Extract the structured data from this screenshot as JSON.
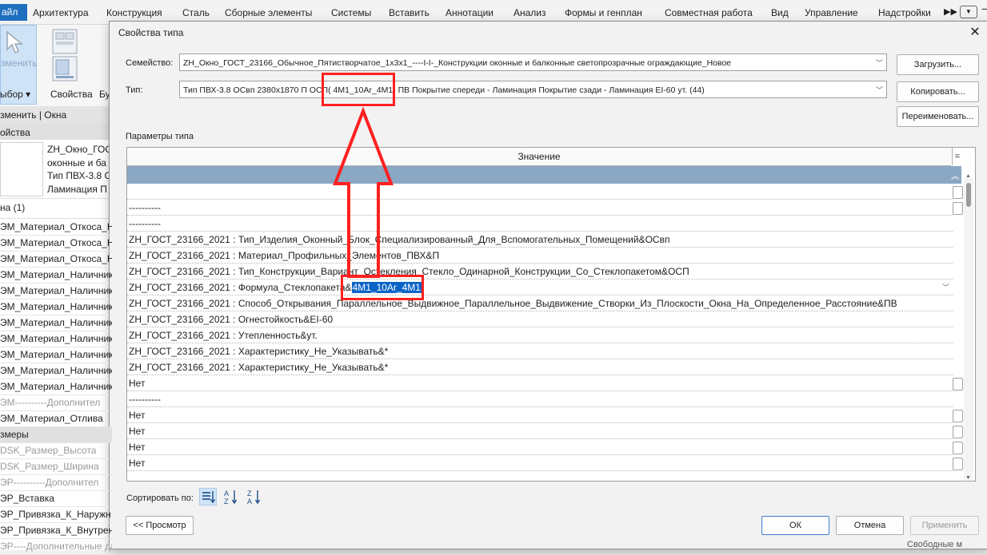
{
  "ribbon": {
    "file_tab": "айл",
    "tabs": [
      "Архитектура",
      "Конструкция",
      "Сталь",
      "Сборные элементы",
      "Системы",
      "Вставить",
      "Аннотации",
      "Анализ",
      "Формы и генплан",
      "Совместная работа",
      "Вид",
      "Управление",
      "Надстройки"
    ],
    "more": "▶▶",
    "select_text": "зменить",
    "select_label": "ыбор ▾",
    "props_label": "Свойства",
    "b_label": "Бу"
  },
  "modify_bar": "зменить | Окна",
  "left_panel": {
    "title": "ойства",
    "type_lines": [
      "ZH_Окно_ГОС",
      "оконные и ба",
      "Тип ПВХ-3.8 О",
      "Ламинация П"
    ],
    "filter": "на (1)",
    "rows": [
      {
        "text": "ЭМ_Материал_Откоса_Н",
        "kind": "normal"
      },
      {
        "text": "ЭМ_Материал_Откоса_Н",
        "kind": "normal"
      },
      {
        "text": "ЭМ_Материал_Откоса_Н",
        "kind": "normal"
      },
      {
        "text": "ЭМ_Материал_Наличник",
        "kind": "normal"
      },
      {
        "text": "ЭМ_Материал_Наличник",
        "kind": "normal"
      },
      {
        "text": "ЭМ_Материал_Наличник",
        "kind": "normal"
      },
      {
        "text": "ЭМ_Материал_Наличник",
        "kind": "normal"
      },
      {
        "text": "ЭМ_Материал_Наличник",
        "kind": "normal"
      },
      {
        "text": "ЭМ_Материал_Наличник",
        "kind": "normal"
      },
      {
        "text": "ЭМ_Материал_Наличник",
        "kind": "normal"
      },
      {
        "text": "ЭМ_Материал_Наличник",
        "kind": "normal"
      },
      {
        "text": "ЭМ----------Дополнител",
        "kind": "grey"
      },
      {
        "text": "ЭМ_Материал_Отлива",
        "kind": "normal"
      },
      {
        "text": "змеры",
        "kind": "group"
      },
      {
        "text": "DSK_Размер_Высота",
        "kind": "grey"
      },
      {
        "text": "DSK_Размер_Ширина",
        "kind": "grey"
      },
      {
        "text": "ЭР----------Дополнител",
        "kind": "grey"
      },
      {
        "text": "ЭР_Вставка",
        "kind": "normal"
      },
      {
        "text": "ЭР_Привязка_К_Наружн",
        "kind": "normal"
      },
      {
        "text": "ЭР_Привязка_К_Внутрен",
        "kind": "normal"
      },
      {
        "text": "ЭР----Дополнительные данные ----------",
        "kind": "grey"
      }
    ]
  },
  "dialog": {
    "title": "Свойства типа",
    "family_label": "Семейство:",
    "family_value": "ZH_Окно_ГОСТ_23166_Обычное_Пятистворчатое_1х3х1_----I-I-_Конструкции оконные и балконные светопрозрачные ограждающие_Новое",
    "type_label": "Тип:",
    "type_value": "Тип ПВХ-3.8 ОСвп 2380х1870 П ОСП( 4М1_10Ar_4М1) ПВ Покрытие спереди - Ламинация Покрытие сзади - Ламинация EI-60 ут. (44)",
    "load_button": "Загрузить...",
    "copy_button": "Копировать...",
    "rename_button": "Переименовать...",
    "params_label": "Параметры типа",
    "grid": {
      "header": "Значение",
      "header_eq": "=",
      "rows": [
        {
          "text": "",
          "check": true
        },
        {
          "text": "----------",
          "check": true
        },
        {
          "text": "----------",
          "check": false
        },
        {
          "text": "ZH_ГОСТ_23166_2021 : Тип_Изделия_Оконный_Блок_Специализированный_Для_Вспомогательных_Помещений&ОСвп",
          "check": false
        },
        {
          "text": "ZH_ГОСТ_23166_2021 : Материал_Профильных_Элементов_ПВХ&П",
          "check": false
        },
        {
          "text": "ZH_ГОСТ_23166_2021 : Тип_Конструкции_Вариант_Остекления_Стекло_Одинарной_Конструкции_Со_Стеклопакетом&ОСП",
          "check": false
        },
        {
          "text": "ZH_ГОСТ_23166_2021 : Формула_Стеклопакета&",
          "highlight": "4М1_10Ar_4М1",
          "check": false,
          "dropdown": true
        },
        {
          "text": "ZH_ГОСТ_23166_2021 : Способ_Открывания_Параллельное_Выдвижное_Параллельное_Выдвижение_Створки_Из_Плоскости_Окна_На_Определенное_Расстояние&ПВ",
          "check": false
        },
        {
          "text": "ZH_ГОСТ_23166_2021 : Огнестойкость&EI-60",
          "check": false
        },
        {
          "text": "ZH_ГОСТ_23166_2021 : Утепленность&ут.",
          "check": false
        },
        {
          "text": "ZH_ГОСТ_23166_2021 : Характеристику_Не_Указывать&*",
          "check": false
        },
        {
          "text": "ZH_ГОСТ_23166_2021 : Характеристику_Не_Указывать&*",
          "check": false
        },
        {
          "text": "Нет",
          "check": true
        },
        {
          "text": "----------",
          "check": false
        },
        {
          "text": "Нет",
          "check": true
        },
        {
          "text": "Нет",
          "check": true
        },
        {
          "text": "Нет",
          "check": true
        },
        {
          "text": "Нет",
          "check": true
        }
      ]
    },
    "sort_label": "Сортировать по:",
    "preview_button": "<< Просмотр",
    "ok_button": "ОК",
    "cancel_button": "Отмена",
    "apply_button": "Применить"
  },
  "colors": {
    "accent": "#1f6fc0",
    "annotation": "#ff2020",
    "selection": "#0a64c8"
  },
  "bottom_strip": "Свободные м"
}
